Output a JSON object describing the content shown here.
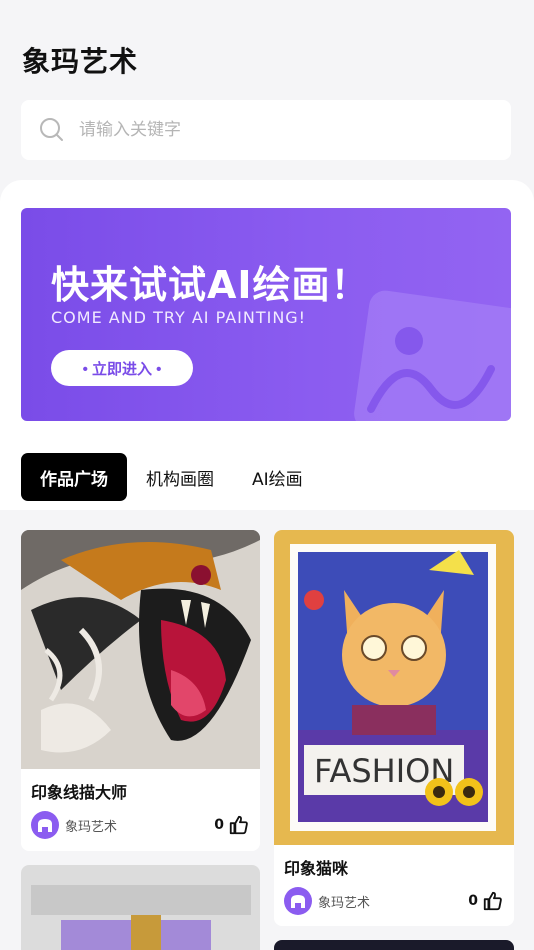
{
  "header": {
    "title": "象玛艺术"
  },
  "search": {
    "placeholder": "请输入关键字"
  },
  "banner": {
    "title": "快来试试AI绘画！",
    "subtitle": "COME AND TRY AI PAINTING!",
    "button_label": "• 立即进入 •"
  },
  "tabs": [
    {
      "label": "作品广场",
      "active": true
    },
    {
      "label": "机构画圈",
      "active": false
    },
    {
      "label": "AI绘画",
      "active": false
    }
  ],
  "works": [
    {
      "title": "印象线描大师",
      "author": "象玛艺术",
      "likes": "0",
      "image": "tiger-painting"
    },
    {
      "title": "印象猫咪",
      "author": "象玛艺术",
      "likes": "0",
      "image": "cat-fashion-drawing"
    }
  ],
  "colors": {
    "accent": "#8b5cf0",
    "tab_active_bg": "#000000"
  }
}
